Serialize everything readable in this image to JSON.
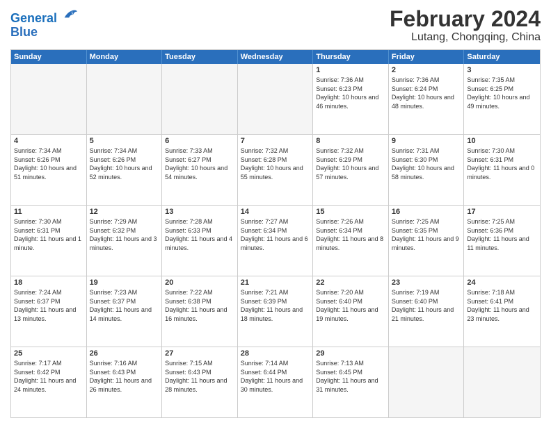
{
  "header": {
    "logo_line1": "General",
    "logo_line2": "Blue",
    "title": "February 2024",
    "subtitle": "Lutang, Chongqing, China"
  },
  "weekdays": [
    "Sunday",
    "Monday",
    "Tuesday",
    "Wednesday",
    "Thursday",
    "Friday",
    "Saturday"
  ],
  "weeks": [
    [
      {
        "day": "",
        "empty": true
      },
      {
        "day": "",
        "empty": true
      },
      {
        "day": "",
        "empty": true
      },
      {
        "day": "",
        "empty": true
      },
      {
        "day": "1",
        "sunrise": "7:36 AM",
        "sunset": "6:23 PM",
        "daylight": "10 hours and 46 minutes."
      },
      {
        "day": "2",
        "sunrise": "7:36 AM",
        "sunset": "6:24 PM",
        "daylight": "10 hours and 48 minutes."
      },
      {
        "day": "3",
        "sunrise": "7:35 AM",
        "sunset": "6:25 PM",
        "daylight": "10 hours and 49 minutes."
      }
    ],
    [
      {
        "day": "4",
        "sunrise": "7:34 AM",
        "sunset": "6:26 PM",
        "daylight": "10 hours and 51 minutes."
      },
      {
        "day": "5",
        "sunrise": "7:34 AM",
        "sunset": "6:26 PM",
        "daylight": "10 hours and 52 minutes."
      },
      {
        "day": "6",
        "sunrise": "7:33 AM",
        "sunset": "6:27 PM",
        "daylight": "10 hours and 54 minutes."
      },
      {
        "day": "7",
        "sunrise": "7:32 AM",
        "sunset": "6:28 PM",
        "daylight": "10 hours and 55 minutes."
      },
      {
        "day": "8",
        "sunrise": "7:32 AM",
        "sunset": "6:29 PM",
        "daylight": "10 hours and 57 minutes."
      },
      {
        "day": "9",
        "sunrise": "7:31 AM",
        "sunset": "6:30 PM",
        "daylight": "10 hours and 58 minutes."
      },
      {
        "day": "10",
        "sunrise": "7:30 AM",
        "sunset": "6:31 PM",
        "daylight": "11 hours and 0 minutes."
      }
    ],
    [
      {
        "day": "11",
        "sunrise": "7:30 AM",
        "sunset": "6:31 PM",
        "daylight": "11 hours and 1 minute."
      },
      {
        "day": "12",
        "sunrise": "7:29 AM",
        "sunset": "6:32 PM",
        "daylight": "11 hours and 3 minutes."
      },
      {
        "day": "13",
        "sunrise": "7:28 AM",
        "sunset": "6:33 PM",
        "daylight": "11 hours and 4 minutes."
      },
      {
        "day": "14",
        "sunrise": "7:27 AM",
        "sunset": "6:34 PM",
        "daylight": "11 hours and 6 minutes."
      },
      {
        "day": "15",
        "sunrise": "7:26 AM",
        "sunset": "6:34 PM",
        "daylight": "11 hours and 8 minutes."
      },
      {
        "day": "16",
        "sunrise": "7:25 AM",
        "sunset": "6:35 PM",
        "daylight": "11 hours and 9 minutes."
      },
      {
        "day": "17",
        "sunrise": "7:25 AM",
        "sunset": "6:36 PM",
        "daylight": "11 hours and 11 minutes."
      }
    ],
    [
      {
        "day": "18",
        "sunrise": "7:24 AM",
        "sunset": "6:37 PM",
        "daylight": "11 hours and 13 minutes."
      },
      {
        "day": "19",
        "sunrise": "7:23 AM",
        "sunset": "6:37 PM",
        "daylight": "11 hours and 14 minutes."
      },
      {
        "day": "20",
        "sunrise": "7:22 AM",
        "sunset": "6:38 PM",
        "daylight": "11 hours and 16 minutes."
      },
      {
        "day": "21",
        "sunrise": "7:21 AM",
        "sunset": "6:39 PM",
        "daylight": "11 hours and 18 minutes."
      },
      {
        "day": "22",
        "sunrise": "7:20 AM",
        "sunset": "6:40 PM",
        "daylight": "11 hours and 19 minutes."
      },
      {
        "day": "23",
        "sunrise": "7:19 AM",
        "sunset": "6:40 PM",
        "daylight": "11 hours and 21 minutes."
      },
      {
        "day": "24",
        "sunrise": "7:18 AM",
        "sunset": "6:41 PM",
        "daylight": "11 hours and 23 minutes."
      }
    ],
    [
      {
        "day": "25",
        "sunrise": "7:17 AM",
        "sunset": "6:42 PM",
        "daylight": "11 hours and 24 minutes."
      },
      {
        "day": "26",
        "sunrise": "7:16 AM",
        "sunset": "6:43 PM",
        "daylight": "11 hours and 26 minutes."
      },
      {
        "day": "27",
        "sunrise": "7:15 AM",
        "sunset": "6:43 PM",
        "daylight": "11 hours and 28 minutes."
      },
      {
        "day": "28",
        "sunrise": "7:14 AM",
        "sunset": "6:44 PM",
        "daylight": "11 hours and 30 minutes."
      },
      {
        "day": "29",
        "sunrise": "7:13 AM",
        "sunset": "6:45 PM",
        "daylight": "11 hours and 31 minutes."
      },
      {
        "day": "",
        "empty": true
      },
      {
        "day": "",
        "empty": true
      }
    ]
  ]
}
